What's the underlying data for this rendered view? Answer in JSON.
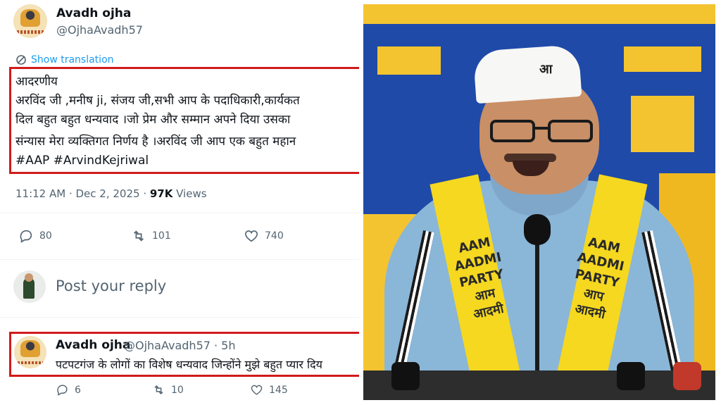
{
  "tweet": {
    "author_name": "Avadh ojha",
    "author_handle": "@OjhaAvadh57",
    "show_translation": "Show translation",
    "lines": [
      "आदरणीय",
      "अरविंद जी ,मनीष ji, संजय जी,सभी आप के पदाधिकारी,कार्यकत",
      "दिल बहुत बहुत धन्यवाद ।जो प्रेम और सम्मान अपने दिया उसका",
      "संन्यास मेरा व्यक्तिगत निर्णय है ।अरविंद जी आप एक बहुत महान"
    ],
    "hashtags": "#AAP #ArvindKejriwal",
    "time": "11:12 AM · Dec 2, 2025 · ",
    "views_count": "97K",
    "views_label": " Views",
    "replies": "80",
    "retweets": "101",
    "likes": "740"
  },
  "reply_box": {
    "placeholder": "Post your reply"
  },
  "reply": {
    "author_name": "Avadh ojha",
    "author_handle": "@OjhaAvadh57 · 5h",
    "text": "पटपटगंज के लोगों का विशेष धन्यवाद जिन्होंने मुझे बहुत प्यार दिय",
    "replies": "6",
    "retweets": "10",
    "likes": "145"
  },
  "photo": {
    "cap_text": "आ",
    "scarf_left": "AAM\nAADMI\nPARTY\nआम\nआदमी",
    "scarf_right": "AAM\nAADMI\nPARTY\nआप\nआदमी",
    "icons": [
      "reply-icon",
      "retweet-icon",
      "like-icon",
      "translate-icon"
    ],
    "colors": {
      "accent": "#1d9bf0",
      "highlight_box": "#d11b1b",
      "scarf": "#f5d81f",
      "backdrop_blue": "#1f4aa8"
    }
  }
}
